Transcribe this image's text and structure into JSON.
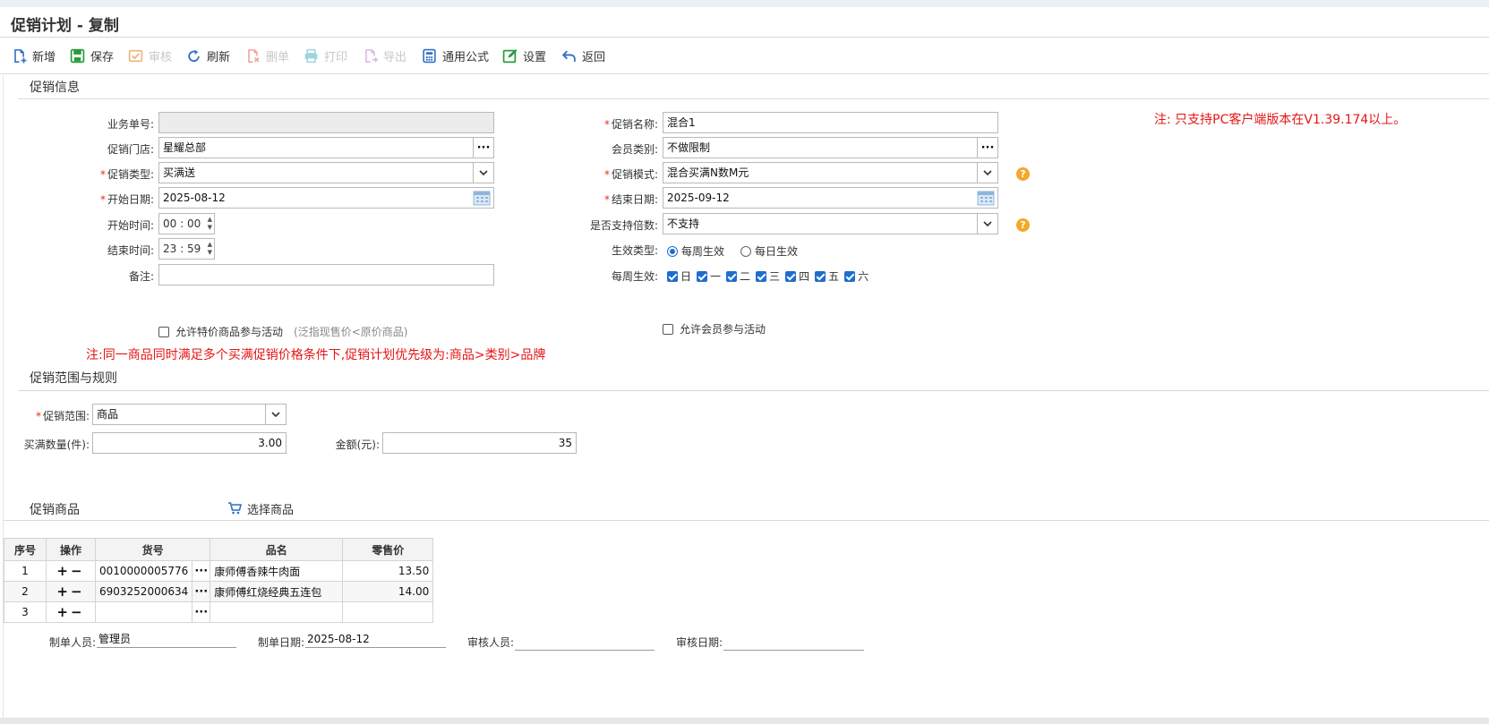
{
  "title": "促销计划 - 复制",
  "toolbar": {
    "add": "新增",
    "save": "保存",
    "audit": "审核",
    "refresh": "刷新",
    "delete": "删单",
    "print": "打印",
    "export": "导出",
    "formula": "通用公式",
    "settings": "设置",
    "back": "返回"
  },
  "info": {
    "section_title": "促销信息",
    "notice": "注: 只支持PC客户端版本在V1.39.174以上。",
    "doc_no_label": "业务单号:",
    "doc_no_value": "",
    "promo_name_label": "促销名称:",
    "promo_name_value": "混合1",
    "store_label": "促销门店:",
    "store_value": "星耀总部",
    "member_type_label": "会员类别:",
    "member_type_value": "不做限制",
    "promo_type_label": "促销类型:",
    "promo_type_value": "买满送",
    "promo_mode_label": "促销模式:",
    "promo_mode_value": "混合买满N数M元",
    "start_date_label": "开始日期:",
    "start_date_value": "2025-08-12",
    "end_date_label": "结束日期:",
    "end_date_value": "2025-09-12",
    "start_time_label": "开始时间:",
    "start_time_value": "00 : 00",
    "multiple_label": "是否支持倍数:",
    "multiple_value": "不支持",
    "end_time_label": "结束时间:",
    "end_time_value": "23 : 59",
    "effect_type_label": "生效类型:",
    "effect_weekly": "每周生效",
    "effect_daily": "每日生效",
    "remark_label": "备注:",
    "remark_value": "",
    "weekly_label": "每周生效:",
    "weekdays": [
      "日",
      "一",
      "二",
      "三",
      "四",
      "五",
      "六"
    ],
    "allow_special": "允许特价商品参与活动",
    "allow_special_hint": "(泛指现售价<原价商品)",
    "allow_member": "允许会员参与活动",
    "priority_note": "注:同一商品同时满足多个买满促销价格条件下,促销计划优先级为:商品>类别>品牌"
  },
  "scope": {
    "section_title": "促销范围与规则",
    "range_label": "促销范围:",
    "range_value": "商品",
    "qty_label": "买满数量(件):",
    "qty_value": "3.00",
    "amount_label": "金额(元):",
    "amount_value": "35"
  },
  "goods": {
    "section_title": "促销商品",
    "select_label": "选择商品",
    "columns": [
      "序号",
      "操作",
      "货号",
      "品名",
      "零售价"
    ],
    "rows": [
      {
        "no": "1",
        "ops": "+ −",
        "code": "0010000005776",
        "name": "康师傅香辣牛肉面",
        "price": "13.50"
      },
      {
        "no": "2",
        "ops": "+ −",
        "code": "6903252000634",
        "name": "康师傅红烧经典五连包",
        "price": "14.00"
      },
      {
        "no": "3",
        "ops": "+ −",
        "code": "",
        "name": "",
        "price": ""
      }
    ]
  },
  "footer": {
    "maker_label": "制单人员:",
    "maker_value": "管理员",
    "make_date_label": "制单日期:",
    "make_date_value": "2025-08-12",
    "auditor_label": "审核人员:",
    "auditor_value": "",
    "audit_date_label": "审核日期:",
    "audit_date_value": ""
  },
  "colors": {
    "accent": "#1d6ecf",
    "required": "#e0301e",
    "notice": "#e61414",
    "help": "#f3a829"
  },
  "icons": [
    "add-doc-icon",
    "save-icon",
    "audit-icon",
    "refresh-icon",
    "delete-doc-icon",
    "print-icon",
    "export-icon",
    "formula-icon",
    "settings-icon",
    "back-icon",
    "calendar-icon",
    "chevron-down-icon",
    "ellipsis-icon",
    "help-icon",
    "cart-icon",
    "plus-icon",
    "minus-icon"
  ]
}
